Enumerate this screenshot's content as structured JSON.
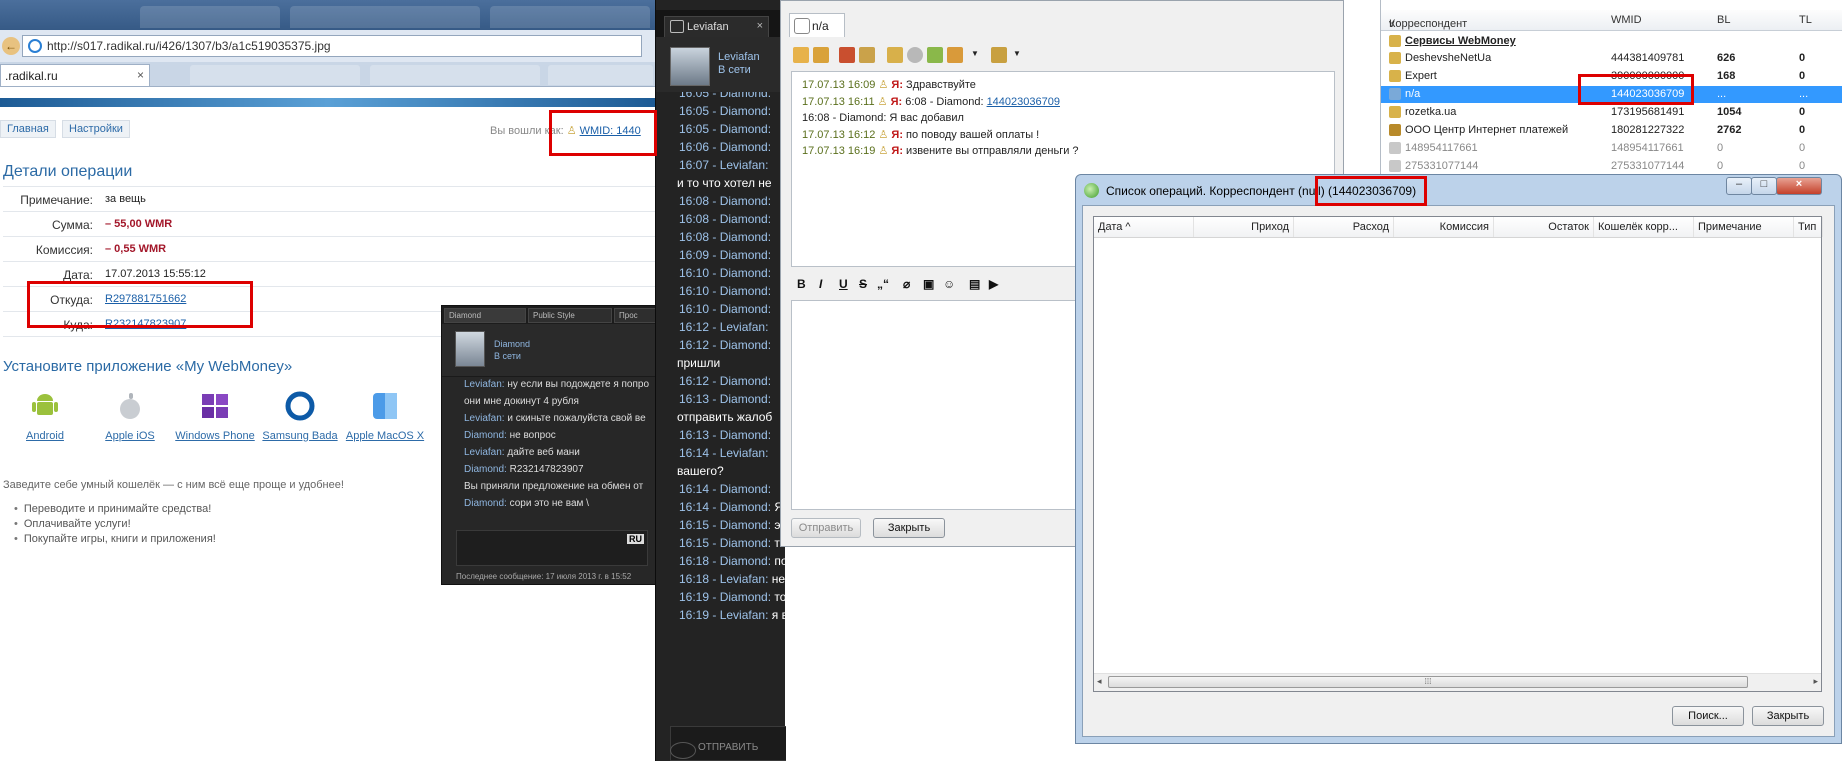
{
  "browser": {
    "url": "http://s017.radikal.ru/i426/1307/b3/a1c519035375.jpg",
    "tab_label": ".radikal.ru",
    "nav": {
      "home": "Главная",
      "settings": "Настройки"
    },
    "logged_prefix": "Вы вошли как:",
    "wmid_label": "WMID: 1440",
    "op_title": "Детали операции",
    "op_rows": [
      {
        "k": "Примечание:",
        "v": "за вещь",
        "style": "plain"
      },
      {
        "k": "Сумма:",
        "v": "– 55,00 WMR",
        "style": "red"
      },
      {
        "k": "Комиссия:",
        "v": "– 0,55 WMR",
        "style": "red"
      },
      {
        "k": "Дата:",
        "v": "17.07.2013 15:55:12",
        "style": "plain"
      },
      {
        "k": "Откуда:",
        "v": "R297881751662",
        "style": "link"
      },
      {
        "k": "Куда:",
        "v": "R232147823907",
        "style": "link"
      }
    ],
    "app_title": "Установите приложение «My WebMoney»",
    "apps": [
      "Android",
      "Apple iOS",
      "Windows Phone",
      "Samsung Bada",
      "Apple MacOS X"
    ],
    "tagline": "Заведите себе умный кошелёк — с ним всё еще проще и удобнее!",
    "bullets": [
      "Переводите и принимайте средства!",
      "Оплачивайте услуги!",
      "Покупайте игры, книги и приложения!"
    ]
  },
  "small_chat": {
    "tabs": [
      "Diamond",
      "Public Style",
      "Прос"
    ],
    "name": "Diamond",
    "status": "В сети",
    "messages": [
      {
        "author": "Leviafan:",
        "text": "ну если вы подождете я попро"
      },
      {
        "author": "",
        "text": "они мне докинут 4 рубля"
      },
      {
        "author": "Leviafan:",
        "text": "и скиньте пожалуйста свой ве"
      },
      {
        "author": "Diamond:",
        "text": "не вопрос"
      },
      {
        "author": "Leviafan:",
        "text": "дайте веб мани"
      },
      {
        "author": "Diamond:",
        "text": "R232147823907"
      },
      {
        "author": "",
        "text": "Вы приняли предложение на обмен от"
      },
      {
        "author": "Diamond:",
        "text": "сори это не вам \\"
      }
    ],
    "lang": "RU",
    "footer": "Последнее сообщение: 17 июля 2013 г. в 15:52"
  },
  "big_chat": {
    "tab": "Leviafan",
    "name": "Leviafan",
    "status": "В сети",
    "rows": [
      {
        "t": "16:05 - Diamond:",
        "m": ""
      },
      {
        "t": "16:05 - Diamond:",
        "m": ""
      },
      {
        "t": "16:05 - Diamond:",
        "m": ""
      },
      {
        "t": "16:06 - Diamond:",
        "m": ""
      },
      {
        "t": "16:07 - Leviafan:",
        "m": ""
      },
      {
        "t": "",
        "m": "и то что хотел не"
      },
      {
        "t": "16:08 - Diamond:",
        "m": ""
      },
      {
        "t": "16:08 - Diamond:",
        "m": ""
      },
      {
        "t": "16:08 - Diamond:",
        "m": ""
      },
      {
        "t": "16:09 - Diamond:",
        "m": ""
      },
      {
        "t": "16:10 - Diamond:",
        "m": ""
      },
      {
        "t": "16:10 - Diamond:",
        "m": ""
      },
      {
        "t": "16:10 - Diamond:",
        "m": ""
      },
      {
        "t": "16:12 - Leviafan:",
        "m": ""
      },
      {
        "t": "16:12 - Diamond:",
        "m": ""
      },
      {
        "t": "",
        "m": "пришли"
      },
      {
        "t": "16:12 - Diamond:",
        "m": ""
      },
      {
        "t": "16:13 - Diamond:",
        "m": ""
      },
      {
        "t": "",
        "m": "отправить жалоб"
      },
      {
        "t": "16:13 - Diamond:",
        "m": ""
      },
      {
        "t": "16:14 - Leviafan:",
        "m": ""
      },
      {
        "t": "",
        "m": "вашего?"
      },
      {
        "t": "16:14 - Diamond:",
        "m": ""
      },
      {
        "t": "16:14 - Diamond:",
        "m": "Я жду !!!"
      },
      {
        "t": "16:15 - Diamond:",
        "m": "это WMID не пренадлежит вам ?"
      },
      {
        "t": "16:15 - Diamond:",
        "m": "тогда кто отправлял деньги ?"
      },
      {
        "t": "16:18 - Diamond:",
        "m": "почему вы не отвечаете через кипер ?"
      },
      {
        "t": "16:18 - Leviafan:",
        "m": "не знаю лаги с сервером"
      },
      {
        "t": "16:19 - Diamond:",
        "m": "тогда как могла пройти оплата ?"
      },
      {
        "t": "16:19 - Leviafan:",
        "m": "я вам скрин предоставил"
      }
    ],
    "send_label": "ОТПРАВИТЬ"
  },
  "na_chat": {
    "tab": "n/a",
    "log": [
      {
        "ts": "17.07.13 16:09",
        "who": "Я:",
        "text": "Здравствуйте",
        "link": ""
      },
      {
        "ts": "17.07.13 16:11",
        "who": "Я:",
        "text": "6:08 - Diamond:",
        "link": "144023036709"
      },
      {
        "ts": "",
        "who": "",
        "text": "16:08 - Diamond: Я вас добавил",
        "link": ""
      },
      {
        "ts": "17.07.13 16:12",
        "who": "Я:",
        "text": "по поводу вашей оплаты !",
        "link": ""
      },
      {
        "ts": "17.07.13 16:19",
        "who": "Я:",
        "text": "извените вы отправляли деньги ?",
        "link": ""
      }
    ],
    "send_btn": "Отправить",
    "close_btn": "Закрыть"
  },
  "wm_list": {
    "headers": {
      "corr": "Корреспондент",
      "wmid": "WMID",
      "bl": "BL",
      "tl": "TL"
    },
    "sort_mark": "v",
    "group": "Сервисы WebMoney",
    "rows": [
      {
        "name": "DeshevsheNetUa",
        "wmid": "444381409781",
        "bl": "626",
        "tl": "0",
        "bold": true,
        "grey": false,
        "sel": false
      },
      {
        "name": "Expert",
        "wmid": "390000000000",
        "bl": "168",
        "tl": "0",
        "bold": true,
        "grey": false,
        "sel": false
      },
      {
        "name": "n/a",
        "wmid": "144023036709",
        "bl": "...",
        "tl": "...",
        "bold": false,
        "grey": false,
        "sel": true
      },
      {
        "name": "rozetka.ua",
        "wmid": "173195681491",
        "bl": "1054",
        "tl": "0",
        "bold": true,
        "grey": false,
        "sel": false
      },
      {
        "name": "ООО Центр Интернет платежей",
        "wmid": "180281227322",
        "bl": "2762",
        "tl": "0",
        "bold": true,
        "grey": false,
        "sel": false
      },
      {
        "name": "148954117661",
        "wmid": "148954117661",
        "bl": "0",
        "tl": "0",
        "bold": false,
        "grey": true,
        "sel": false
      },
      {
        "name": "275331077144",
        "wmid": "275331077144",
        "bl": "0",
        "tl": "0",
        "bold": false,
        "grey": true,
        "sel": false
      }
    ]
  },
  "ops_dialog": {
    "title": "Список операций. Корреспондент (null) (144023036709)",
    "columns": [
      "Дата ^",
      "Приход",
      "Расход",
      "Комиссия",
      "Остаток",
      "Кошелёк корр...",
      "Примечание",
      "Тип"
    ],
    "grip": "⁞⁞⁞",
    "search_btn": "Поиск...",
    "close_btn": "Закрыть"
  }
}
